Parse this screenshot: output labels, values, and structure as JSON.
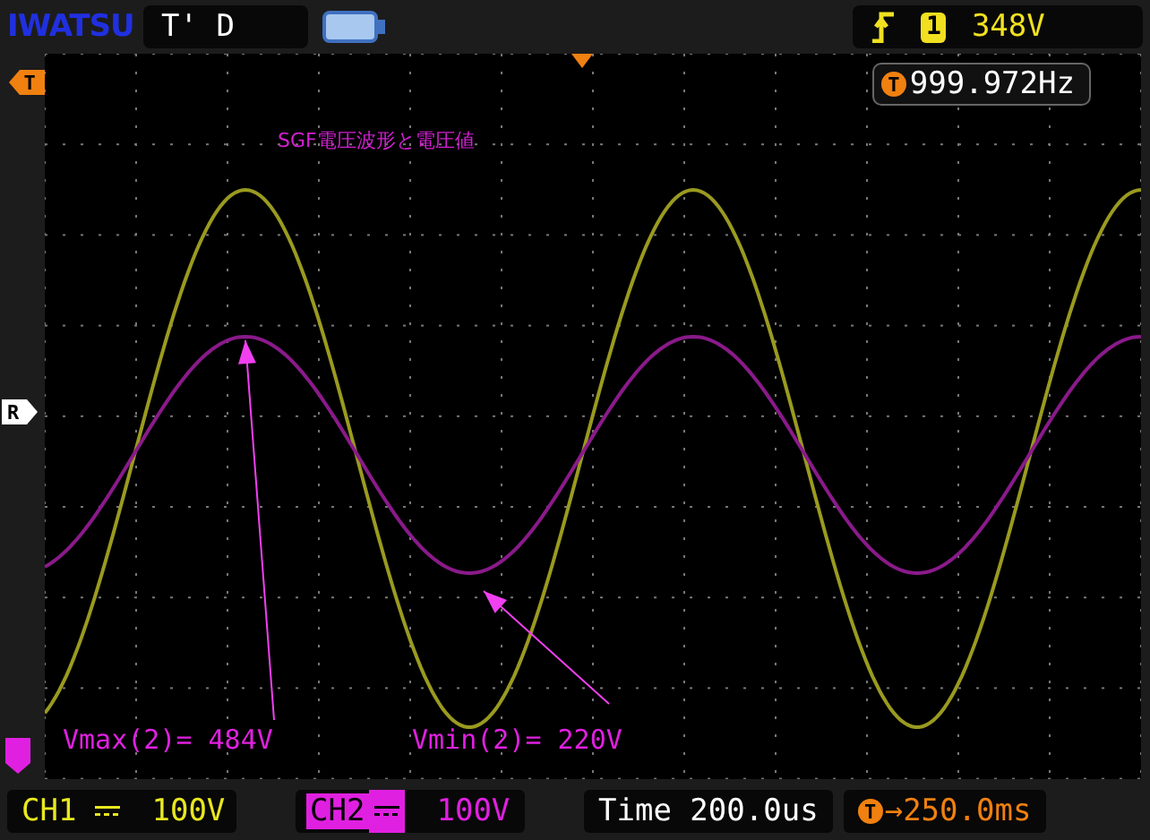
{
  "top_bar": {
    "brand": "IWATSU",
    "trigger_status": "T' D",
    "trigger": {
      "source": "1",
      "level": "348V"
    }
  },
  "screen": {
    "trigger_marker": "T",
    "frequency_readout": {
      "marker": "T",
      "value": "999.972Hz"
    },
    "title": "SGF電圧波形と電圧値",
    "ref_marker": "R",
    "annotations": [
      {
        "text": "Vmax(2)= 484V"
      },
      {
        "text": "Vmin(2)= 220V"
      }
    ]
  },
  "bottom_bar": {
    "channels": [
      {
        "label": "CH1",
        "scale": "100V",
        "selected": false,
        "color": "#e8e820"
      },
      {
        "label": "CH2",
        "scale": "100V",
        "selected": true,
        "color": "#e020e0"
      }
    ],
    "time_base": "Time 200.0us",
    "delay_marker": "T",
    "delay": "→250.0ms"
  }
}
